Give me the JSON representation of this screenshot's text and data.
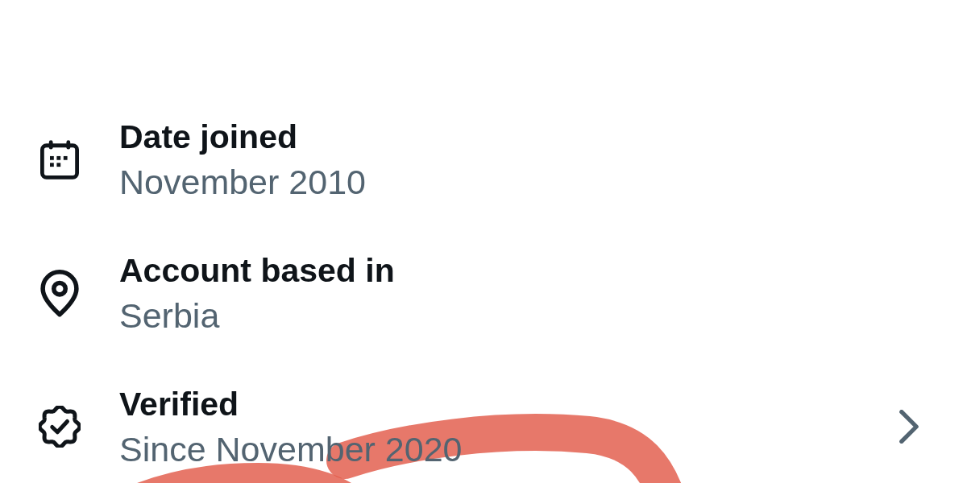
{
  "rows": [
    {
      "kind": "calendar",
      "title": "Date joined",
      "subtitle": "November 2010",
      "chevron": false
    },
    {
      "kind": "location",
      "title": "Account based in",
      "subtitle": "Serbia",
      "chevron": false
    },
    {
      "kind": "verified",
      "title": "Verified",
      "subtitle": "Since November 2020",
      "chevron": true
    }
  ]
}
